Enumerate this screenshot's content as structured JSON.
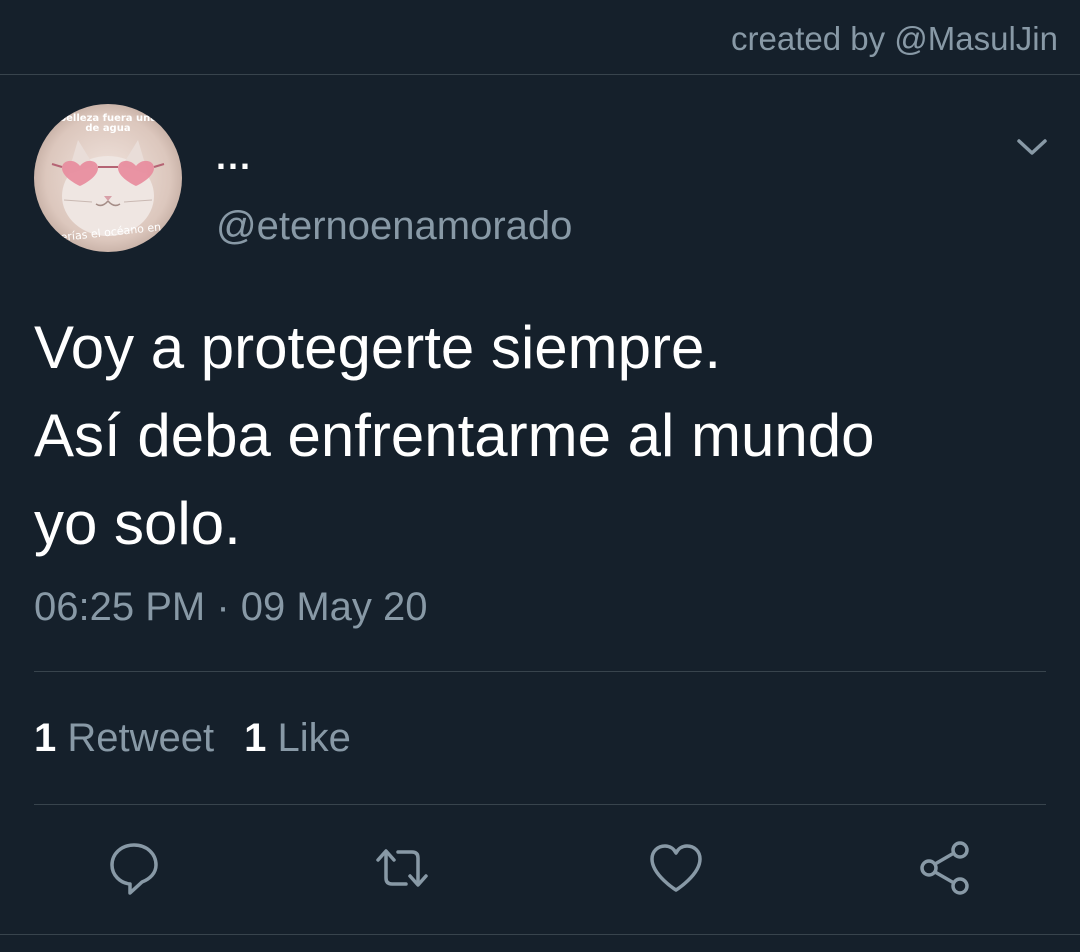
{
  "header": {
    "credit": "created by @MasulJin"
  },
  "tweet": {
    "display_name": "...",
    "handle": "@eternoenamorado",
    "avatar_caption_top": "belleza fuera una de agua",
    "avatar_caption_bottom": "serías el océano en",
    "text_lines": [
      "Voy a protegerte siempre.",
      "Así deba enfrentarme al mundo",
      "yo solo."
    ],
    "timestamp": "06:25 PM · 09 May 20"
  },
  "stats": {
    "retweets_count": "1",
    "retweets_label": "Retweet",
    "likes_count": "1",
    "likes_label": "Like"
  },
  "actions": {
    "reply_icon": "reply-icon",
    "retweet_icon": "retweet-icon",
    "like_icon": "like-icon",
    "share_icon": "share-icon"
  },
  "colors": {
    "background": "#15202b",
    "secondary_text": "#8899a6",
    "divider": "#38444d",
    "primary_text": "#ffffff"
  }
}
